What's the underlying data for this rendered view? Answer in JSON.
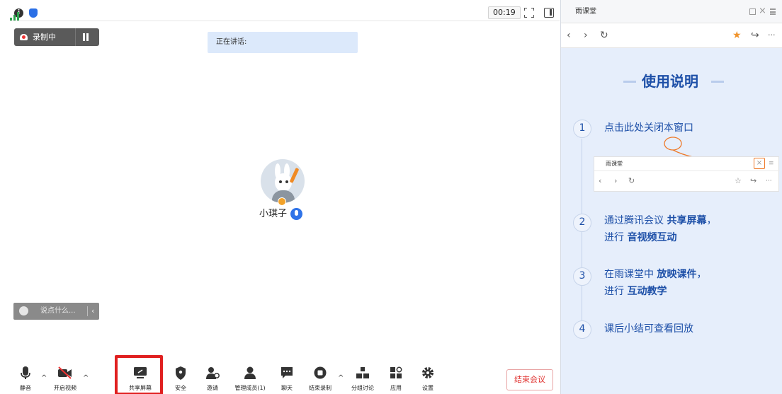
{
  "top_bar": {
    "info_icon": "info-icon",
    "shield_icon": "shield-icon",
    "signal_icon": "signal-icon",
    "timer": "00:19",
    "fullscreen_icon": "fullscreen-icon",
    "layout_icon": "layout-icon"
  },
  "recording": {
    "label": "录制中",
    "pause_icon": "pause-icon",
    "stop_icon": "stop-icon"
  },
  "speaking": {
    "label": "正在讲话:"
  },
  "participant": {
    "name": "小琪子"
  },
  "chat": {
    "placeholder": "说点什么...",
    "collapse_glyph": "‹"
  },
  "toolbar": {
    "mute": "静音",
    "video": "开启视频",
    "share": "共享屏幕",
    "security": "安全",
    "invite": "邀请",
    "manage": "管理成员(1)",
    "chat": "聊天",
    "end_recording": "结束录制",
    "breakout": "分组讨论",
    "apps": "应用",
    "settings": "设置",
    "end_meeting": "结束会议",
    "caret": "^"
  },
  "panel": {
    "title": "雨课堂",
    "close_glyph": "×",
    "nav": {
      "back": "‹",
      "forward": "›",
      "refresh": "↻",
      "star": "★",
      "share": "↪",
      "more": "···"
    },
    "guide_title": "使用说明",
    "steps": [
      {
        "num": "1",
        "line1": "点击此处关闭本窗口"
      },
      {
        "num": "2",
        "pre": "通过腾讯会议 ",
        "bold": "共享屏幕",
        "post": "，",
        "pre2": "进行 ",
        "bold2": "音视频互动"
      },
      {
        "num": "3",
        "pre": "在雨课堂中 ",
        "bold": "放映课件",
        "post": "，",
        "pre2": "进行 ",
        "bold2": "互动教学"
      },
      {
        "num": "4",
        "line1": "课后小结可查看回放"
      }
    ],
    "mini": {
      "title": "雨课堂",
      "close_glyph": "×",
      "menu_glyph": "≡",
      "nav": {
        "back": "‹",
        "forward": "›",
        "refresh": "↻",
        "star": "☆",
        "share": "↪",
        "more": "···"
      }
    }
  },
  "colors": {
    "accent_blue": "#1e50a8",
    "panel_bg": "#e6eefb",
    "highlight_red": "#e02020",
    "end_meeting_red": "#e0322f",
    "pointer_orange": "#ee7a2a"
  }
}
